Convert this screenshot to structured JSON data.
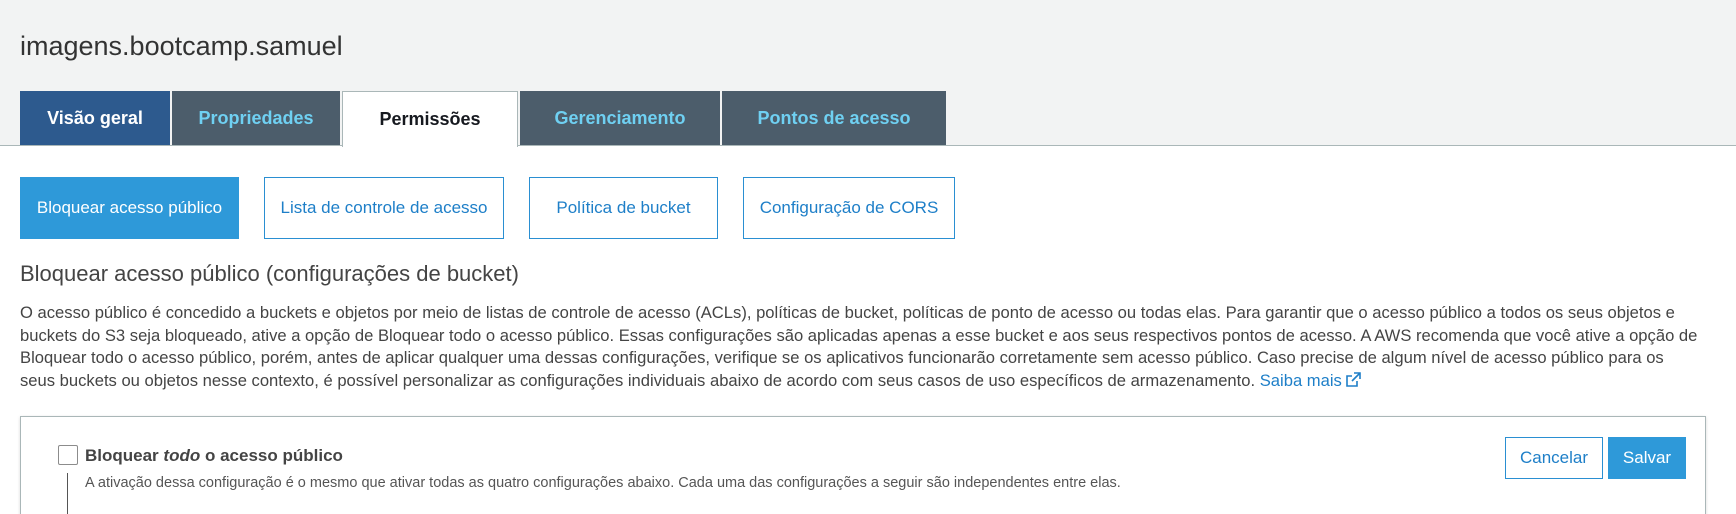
{
  "bucket": {
    "name": "imagens.bootcamp.samuel"
  },
  "main_tabs": [
    {
      "label": "Visão geral"
    },
    {
      "label": "Propriedades"
    },
    {
      "label": "Permissões"
    },
    {
      "label": "Gerenciamento"
    },
    {
      "label": "Pontos de acesso"
    }
  ],
  "sub_tabs": [
    {
      "label": "Bloquear acesso público"
    },
    {
      "label": "Lista de controle de acesso"
    },
    {
      "label": "Política de bucket"
    },
    {
      "label": "Configuração de CORS"
    }
  ],
  "section": {
    "title": "Bloquear acesso público (configurações de bucket)",
    "description": "O acesso público é concedido a buckets e objetos por meio de listas de controle de acesso (ACLs), políticas de bucket, políticas de ponto de acesso ou todas elas. Para garantir que o acesso público a todos os seus objetos e buckets do S3 seja bloqueado, ative a opção de Bloquear todo o acesso público. Essas configurações são aplicadas apenas a esse bucket e aos seus respectivos pontos de acesso. A AWS recomenda que você ative a opção de Bloquear todo o acesso público, porém, antes de aplicar qualquer uma dessas configurações, verifique se os aplicativos funcionarão corretamente sem acesso público. Caso precise de algum nível de acesso público para os seus buckets ou objetos nesse contexto, é possível personalizar as configurações individuais abaixo de acordo com seus casos de uso específicos de armazenamento.",
    "learn_more": "Saiba mais"
  },
  "block_all": {
    "label_prefix": "Bloquear",
    "label_em": "todo",
    "label_suffix": "o acesso público",
    "help": "A ativação dessa configuração é o mesmo que ativar todas as quatro configurações abaixo. Cada uma das configurações a seguir são independentes entre elas.",
    "checked": false
  },
  "actions": {
    "cancel": "Cancelar",
    "save": "Salvar"
  },
  "colors": {
    "primary": "#2e99d9",
    "link": "#1e7fc8",
    "tab_dark": "#4c5d6b",
    "tab_first": "#2d5a8e",
    "tab_text": "#6fd0f2"
  }
}
